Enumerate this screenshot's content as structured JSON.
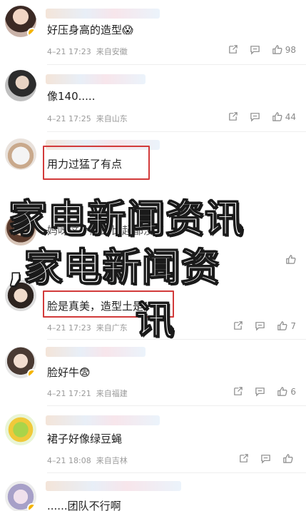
{
  "overlay": {
    "line1": "家电新闻资讯",
    "line2": ",家电新闻资",
    "line3": "讯"
  },
  "comments": [
    {
      "text": "好压身高的造型",
      "emoji": "😱",
      "time": "4–21 17:23",
      "location": "来自安徽",
      "like_count": "98"
    },
    {
      "text": "像140.....",
      "emoji": "",
      "time": "4–21 17:25",
      "location": "来自山东",
      "like_count": "44"
    },
    {
      "text": "用力过猛了有点",
      "emoji": "",
      "time": "",
      "location": "",
      "like_count": ""
    },
    {
      "text": "妈呀这个脸的比起都没了",
      "emoji": "",
      "time": "",
      "location": "",
      "like_count": ""
    },
    {
      "text": "脸是真美，造型土是！",
      "emoji": "",
      "time": "4–21 17:23",
      "location": "来自广东",
      "like_count": "7"
    },
    {
      "text": "脸好牛",
      "emoji": "😨",
      "time": "4–21 17:21",
      "location": "来自福建",
      "like_count": "6"
    },
    {
      "text": "裙子好像绿豆蝇",
      "emoji": "",
      "time": "4–21 18:08",
      "location": "来自吉林",
      "like_count": ""
    },
    {
      "text": "......团队不行啊",
      "emoji": "",
      "time": "",
      "location": "",
      "like_count": ""
    }
  ],
  "icons": {
    "share": "share-icon",
    "reply": "comment-icon",
    "like": "thumbs-up-icon"
  },
  "colors": {
    "highlight_box": "#d23a3a",
    "badge": "#f5b400",
    "meta_text": "#9a9a9a"
  }
}
